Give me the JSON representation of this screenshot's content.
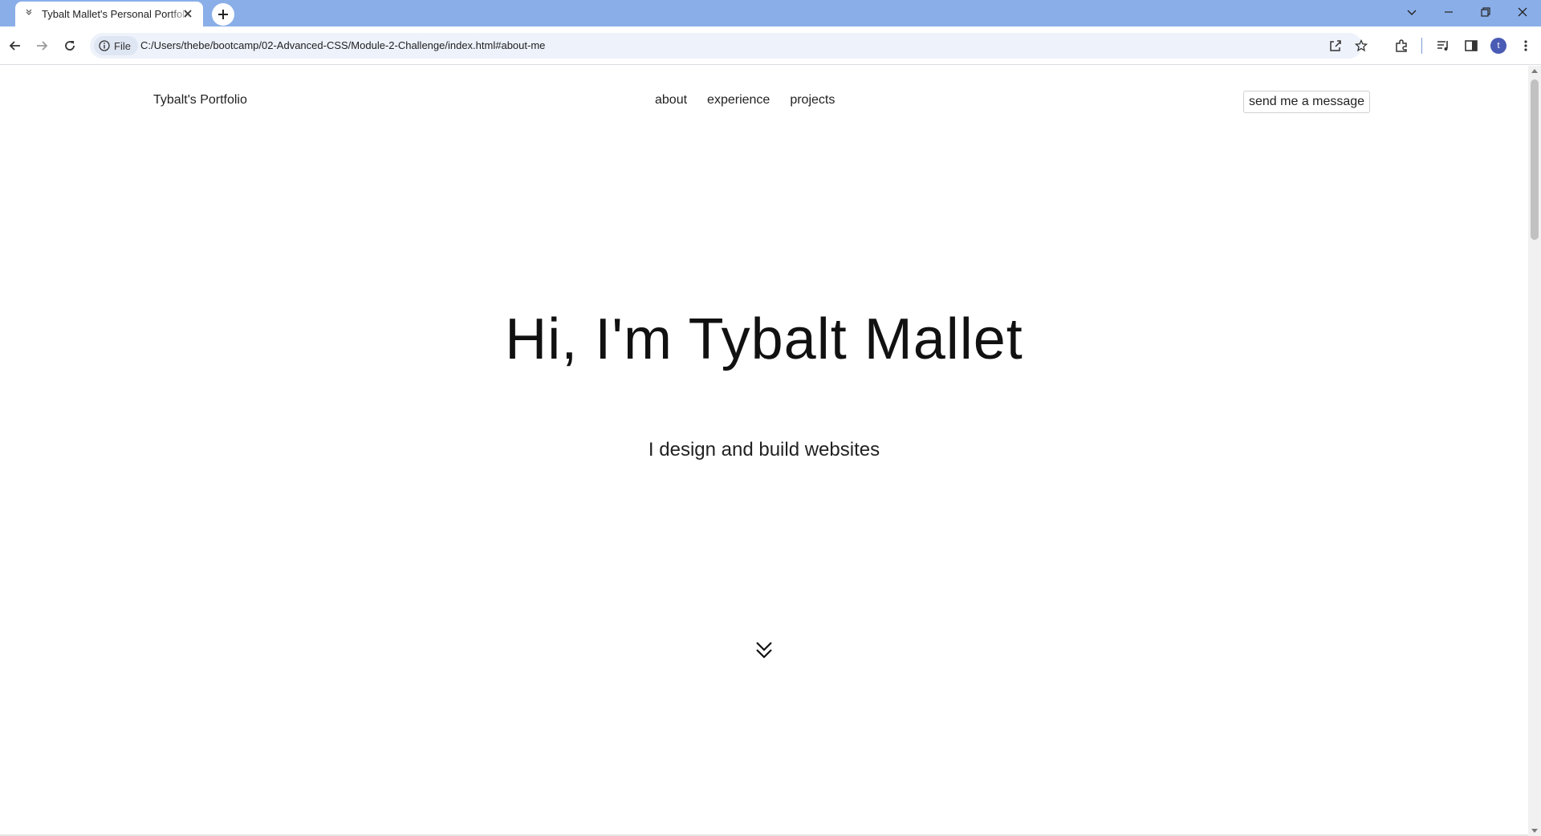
{
  "browser": {
    "tab_title": "Tybalt Mallet's Personal Portfolio",
    "site_chip_label": "File",
    "url": "C:/Users/thebe/bootcamp/02-Advanced-CSS/Module-2-Challenge/index.html#about-me",
    "profile_initial": "t"
  },
  "site": {
    "brand": "Tybalt's Portfolio",
    "nav": [
      {
        "label": "about"
      },
      {
        "label": "experience"
      },
      {
        "label": "projects"
      }
    ],
    "cta_label": "send me a message"
  },
  "hero": {
    "title": "Hi, I'm Tybalt Mallet",
    "subtitle": "I design and build websites"
  },
  "colors": {
    "tabstrip": "#8aaee8",
    "text": "#111111",
    "background": "#ffffff"
  },
  "icons": [
    "chevron-down-icon",
    "close-icon",
    "plus-icon",
    "back-icon",
    "forward-icon",
    "reload-icon",
    "info-icon",
    "share-icon",
    "star-icon",
    "extensions-icon",
    "media-icon",
    "sidepanel-icon",
    "menu-icon",
    "double-chevron-down-icon"
  ]
}
